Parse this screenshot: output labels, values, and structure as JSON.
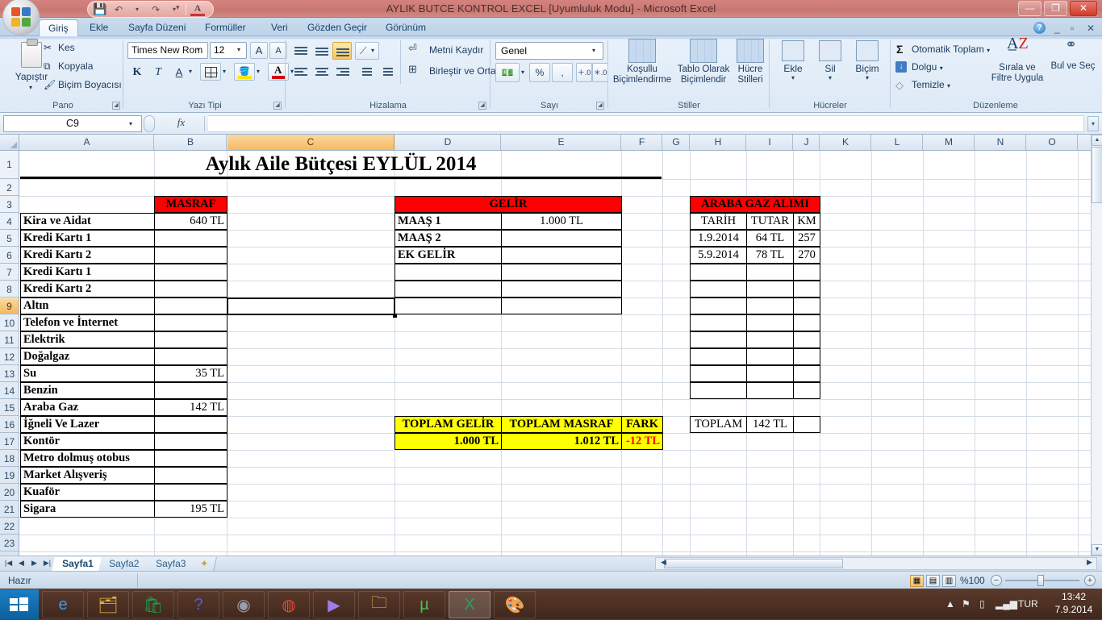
{
  "window": {
    "title": "AYLIK BUTCE KONTROL EXCEL  [Uyumluluk Modu] - Microsoft Excel",
    "minimize": "—",
    "maximize": "❐",
    "close": "✕"
  },
  "qat": {
    "save": "💾",
    "undo": "↶",
    "undo_arrow": "▾",
    "redo": "↷",
    "redo_arrow": "▾",
    "font_a": "A",
    "more": "▾"
  },
  "ribbon": {
    "tabs": [
      {
        "label": "Giriş",
        "active": true
      },
      {
        "label": "Ekle",
        "active": false
      },
      {
        "label": "Sayfa Düzeni",
        "active": false
      },
      {
        "label": "Formüller",
        "active": false
      },
      {
        "label": "Veri",
        "active": false
      },
      {
        "label": "Gözden Geçir",
        "active": false
      },
      {
        "label": "Görünüm",
        "active": false
      }
    ],
    "help": "?",
    "min": "_",
    "restore": "▫",
    "close": "✕",
    "pano": {
      "label": "Pano",
      "paste": "Yapıştır",
      "paste_arrow": "▾",
      "cut": "Kes",
      "cut_icon": "✂",
      "copy": "Kopyala",
      "copy_icon": "⧉",
      "format_painter": "Biçim Boyacısı",
      "fp_icon": "🖌"
    },
    "font": {
      "label": "Yazı Tipi",
      "font_name": "Times New Rom",
      "font_size": "12",
      "grow": "A",
      "shrink": "A",
      "bold": "K",
      "italic": "T",
      "underline": "A",
      "arrow": "▾"
    },
    "align": {
      "label": "Hizalama",
      "wrap_text": "Metni Kaydır",
      "merge_center": "Birleştir ve Ortala",
      "merge_arrow": "▾",
      "orient_icon": "⟋",
      "wrap_icon": "⏎",
      "merge_icon": "⊞"
    },
    "number": {
      "label": "Sayı",
      "format": "Genel",
      "currency": "💵",
      "percent": "%",
      "comma": ",",
      "inc_dec": "＋.0",
      "dec_dec": "＊.0",
      "arrow": "▾"
    },
    "styles": {
      "label": "Stiller",
      "conditional": "Koşullu Biçimlendirme",
      "as_table": "Tablo Olarak Biçimlendir",
      "cell_styles": "Hücre Stilleri",
      "arrow": "▾"
    },
    "cells": {
      "label": "Hücreler",
      "insert": "Ekle",
      "delete": "Sil",
      "format": "Biçim",
      "arrow": "▾"
    },
    "editing": {
      "label": "Düzenleme",
      "autosum": "Otomatik Toplam",
      "fill": "Dolgu",
      "clear": "Temizle",
      "sort_filter": "Sırala ve Filtre Uygula",
      "find_select": "Bul ve Seç",
      "sigma": "Σ",
      "arrow": "▾"
    }
  },
  "formula_bar": {
    "name_box": "C9",
    "fx": "fx",
    "formula_value": "",
    "arrow": "▾",
    "expand": "▾"
  },
  "grid": {
    "columns": [
      "A",
      "B",
      "C",
      "D",
      "E",
      "F",
      "G",
      "H",
      "I",
      "J",
      "K",
      "L",
      "M",
      "N",
      "O"
    ],
    "selected_column": "C",
    "rows": [
      "1",
      "2",
      "3",
      "4",
      "5",
      "6",
      "7",
      "8",
      "9",
      "10",
      "11",
      "12",
      "13",
      "14",
      "15",
      "16",
      "17",
      "18",
      "19",
      "20",
      "21",
      "22",
      "23"
    ],
    "selected_row": "9",
    "active_cell": "C9",
    "title": "Aylık Aile Bütçesi EYLÜL 2014",
    "masraf_header": "MASRAF",
    "gelir_header": "GELİR",
    "araba_header": "ARABA GAZ ALIMI",
    "expenses": [
      {
        "row": "4",
        "name": "Kira ve Aidat",
        "amount": "640 TL"
      },
      {
        "row": "5",
        "name": "Kredi Kartı 1",
        "amount": ""
      },
      {
        "row": "6",
        "name": "Kredi Kartı 2",
        "amount": ""
      },
      {
        "row": "7",
        "name": "Kredi Kartı 1",
        "amount": ""
      },
      {
        "row": "8",
        "name": "Kredi Kartı 2",
        "amount": ""
      },
      {
        "row": "9",
        "name": "Altın",
        "amount": ""
      },
      {
        "row": "10",
        "name": "Telefon ve İnternet",
        "amount": ""
      },
      {
        "row": "11",
        "name": "Elektrik",
        "amount": ""
      },
      {
        "row": "12",
        "name": "Doğalgaz",
        "amount": ""
      },
      {
        "row": "13",
        "name": "Su",
        "amount": "35 TL"
      },
      {
        "row": "14",
        "name": "Benzin",
        "amount": ""
      },
      {
        "row": "15",
        "name": "Araba Gaz",
        "amount": "142 TL"
      },
      {
        "row": "16",
        "name": "İğneli Ve Lazer",
        "amount": ""
      },
      {
        "row": "17",
        "name": "Kontör",
        "amount": ""
      },
      {
        "row": "18",
        "name": "Metro dolmuş otobus",
        "amount": ""
      },
      {
        "row": "19",
        "name": "Market Alışveriş",
        "amount": ""
      },
      {
        "row": "20",
        "name": "Kuaför",
        "amount": ""
      },
      {
        "row": "21",
        "name": "Sigara",
        "amount": "195 TL"
      }
    ],
    "income": [
      {
        "row": "4",
        "name": "MAAŞ 1",
        "amount": "1.000 TL"
      },
      {
        "row": "5",
        "name": "MAAŞ 2",
        "amount": ""
      },
      {
        "row": "6",
        "name": "EK GELİR",
        "amount": ""
      },
      {
        "row": "7",
        "name": "",
        "amount": ""
      },
      {
        "row": "8",
        "name": "",
        "amount": ""
      },
      {
        "row": "9",
        "name": "",
        "amount": ""
      }
    ],
    "summary": {
      "toplam_gelir_label": "TOPLAM GELİR",
      "toplam_masraf_label": "TOPLAM MASRAF",
      "fark_label": "FARK",
      "toplam_gelir_value": "1.000 TL",
      "toplam_masraf_value": "1.012 TL",
      "fark_value": "-12 TL"
    },
    "araba": {
      "col_tarih": "TARİH",
      "col_tutar": "TUTAR",
      "col_km": "KM",
      "rows": [
        {
          "tarih": "1.9.2014",
          "tutar": "64 TL",
          "km": "257"
        },
        {
          "tarih": "5.9.2014",
          "tutar": "78 TL",
          "km": "270"
        },
        {
          "tarih": "",
          "tutar": "",
          "km": ""
        },
        {
          "tarih": "",
          "tutar": "",
          "km": ""
        },
        {
          "tarih": "",
          "tutar": "",
          "km": ""
        },
        {
          "tarih": "",
          "tutar": "",
          "km": ""
        },
        {
          "tarih": "",
          "tutar": "",
          "km": ""
        },
        {
          "tarih": "",
          "tutar": "",
          "km": ""
        },
        {
          "tarih": "",
          "tutar": "",
          "km": ""
        },
        {
          "tarih": "",
          "tutar": "",
          "km": ""
        }
      ],
      "total_label": "TOPLAM",
      "total_value": "142 TL"
    }
  },
  "sheet_tabs": {
    "first": "|◀",
    "prev": "◀",
    "next": "▶",
    "last": "▶|",
    "sheets": [
      {
        "label": "Sayfa1",
        "active": true
      },
      {
        "label": "Sayfa2",
        "active": false
      },
      {
        "label": "Sayfa3",
        "active": false
      }
    ],
    "insert_sheet": "✦"
  },
  "status_bar": {
    "status": "Hazır",
    "zoom": "%100",
    "zoom_out": "−",
    "zoom_in": "+",
    "view_normal": "▦",
    "view_layout": "▤",
    "view_break": "▥"
  },
  "taskbar": {
    "start": "⊞",
    "items": [
      {
        "name": "internet-explorer",
        "glyph": "e",
        "color": "#2a7fd4"
      },
      {
        "name": "file-explorer",
        "glyph": "🗂",
        "color": "#e8b84b"
      },
      {
        "name": "windows-store",
        "glyph": "🛍",
        "color": "#0c8a3e"
      },
      {
        "name": "help-app",
        "glyph": "?",
        "color": "#2b3f9e"
      },
      {
        "name": "media-player",
        "glyph": "◉",
        "color": "#4a4a52"
      },
      {
        "name": "google-chrome",
        "glyph": "◍",
        "color": "#d84b3a"
      },
      {
        "name": "media-app",
        "glyph": "▶",
        "color": "#8b5fd0"
      },
      {
        "name": "folder-app",
        "glyph": "🗀",
        "color": "#e5c463"
      },
      {
        "name": "utorrent",
        "glyph": "µ",
        "color": "#3fa349"
      },
      {
        "name": "microsoft-excel",
        "glyph": "X",
        "color": "#1f7246"
      },
      {
        "name": "paint-app",
        "glyph": "🎨",
        "color": "#5d8bbf"
      }
    ],
    "tray": {
      "show_hidden": "▲",
      "flag": "⚑",
      "battery": "▯",
      "signal": "▂▄▆",
      "language": "TUR",
      "time": "13:42",
      "date": "7.9.2014"
    }
  }
}
